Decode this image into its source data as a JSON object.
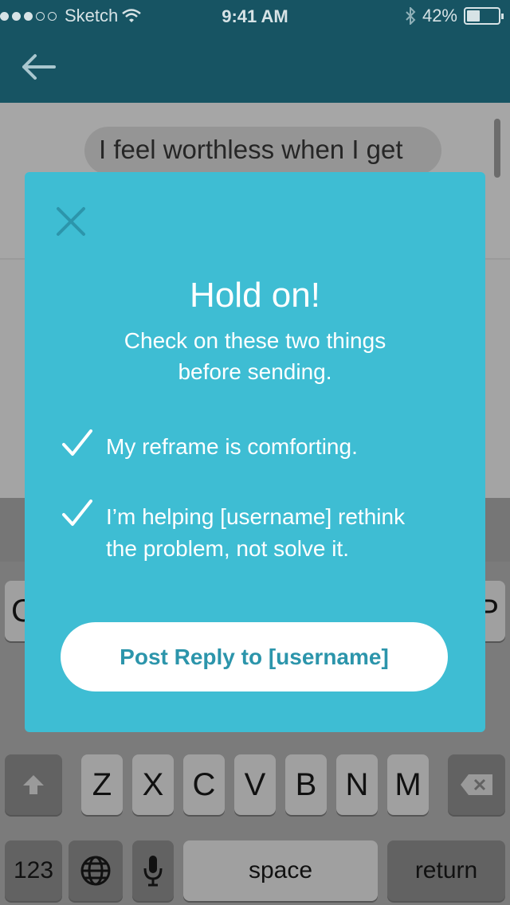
{
  "status_bar": {
    "carrier": "Sketch",
    "time": "9:41 AM",
    "battery": "42%",
    "battery_level": 0.42,
    "signal_dots_filled": 3,
    "signal_dots_total": 5
  },
  "nav": {
    "back_icon": "arrow-left-icon"
  },
  "background": {
    "message_preview": "I feel worthless when I get"
  },
  "keyboard": {
    "row_mid_left_partial": "C",
    "row_mid_right_partial": "P",
    "row_bottom": [
      "Z",
      "X",
      "C",
      "V",
      "B",
      "N",
      "M"
    ],
    "numbers_label": "123",
    "space_label": "space",
    "return_label": "return"
  },
  "modal": {
    "close_icon": "close-icon",
    "title": "Hold on!",
    "subtitle_line1": "Check on these two things",
    "subtitle_line2": "before sending.",
    "items": [
      {
        "line1": "My reframe is comforting."
      },
      {
        "line1": "I’m helping [username] rethink",
        "line2": "the problem, not solve it."
      }
    ],
    "cta_label": "Post Reply to [username]"
  },
  "colors": {
    "nav_bar": "#175463",
    "modal_background": "#3ebdd3",
    "cta_text": "#2c95ab",
    "close_icon": "#2c95ab"
  }
}
